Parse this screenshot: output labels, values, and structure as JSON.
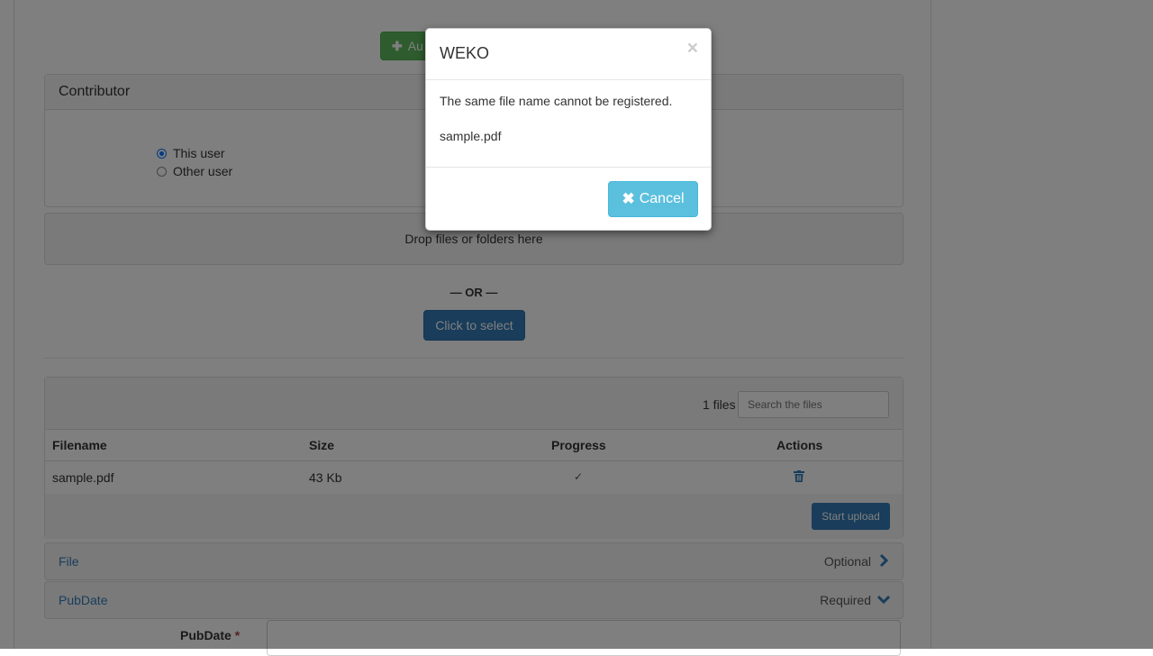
{
  "background": {
    "add_button_label": "Au",
    "contributor": {
      "title": "Contributor",
      "options": [
        {
          "label": "This user",
          "checked": true
        },
        {
          "label": "Other user",
          "checked": false
        }
      ]
    },
    "dropzone_text": "Drop files or folders here",
    "or_text": "— OR —",
    "select_button": "Click to select",
    "files": {
      "count": "1 files",
      "search_placeholder": "Search the files",
      "columns": [
        "Filename",
        "Size",
        "Progress",
        "Actions"
      ],
      "rows": [
        {
          "filename": "sample.pdf",
          "size": "43 Kb",
          "progress": "✓"
        }
      ],
      "start_upload": "Start upload"
    },
    "sections": [
      {
        "title": "File",
        "status": "Optional",
        "chevron": "chevron-right-icon"
      },
      {
        "title": "PubDate",
        "status": "Required",
        "chevron": "chevron-down-icon"
      }
    ],
    "pubdate_label": "PubDate",
    "required_star": "*"
  },
  "modal": {
    "title": "WEKO",
    "close": "×",
    "message": "The same file name cannot be registered.",
    "filename": "sample.pdf",
    "cancel_label": "Cancel"
  }
}
